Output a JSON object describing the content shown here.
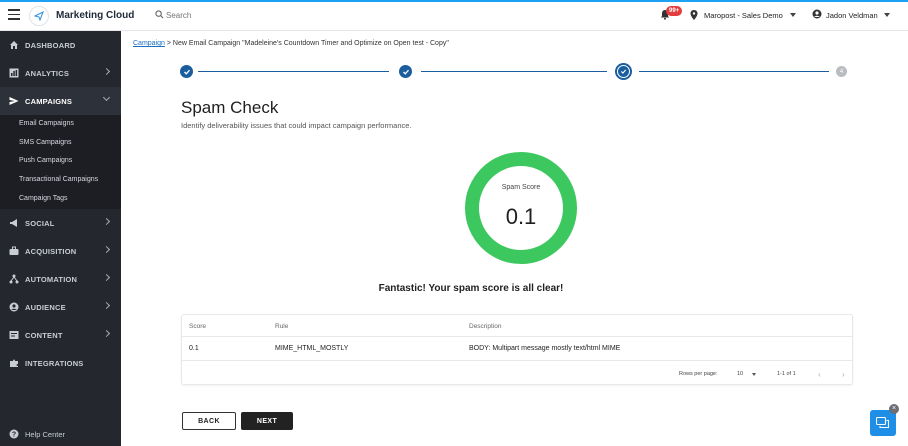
{
  "app": {
    "title": "Marketing Cloud"
  },
  "topbar": {
    "search_placeholder": "Search",
    "notification_badge": "99+",
    "account": "Maropost - Sales Demo",
    "user": "Jadon Veldman"
  },
  "sidebar": {
    "items": [
      {
        "label": "DASHBOARD",
        "icon": "home-icon"
      },
      {
        "label": "ANALYTICS",
        "icon": "chart-icon"
      },
      {
        "label": "CAMPAIGNS",
        "icon": "send-icon"
      },
      {
        "label": "SOCIAL",
        "icon": "megaphone-icon"
      },
      {
        "label": "ACQUISITION",
        "icon": "briefcase-icon"
      },
      {
        "label": "AUTOMATION",
        "icon": "flow-icon"
      },
      {
        "label": "AUDIENCE",
        "icon": "person-icon"
      },
      {
        "label": "CONTENT",
        "icon": "content-icon"
      },
      {
        "label": "INTEGRATIONS",
        "icon": "puzzle-icon"
      }
    ],
    "campaigns_sub": [
      "Email Campaigns",
      "SMS Campaigns",
      "Push Campaigns",
      "Transactional Campaigns",
      "Campaign Tags"
    ],
    "help": "Help Center"
  },
  "breadcrumb": {
    "link": "Campaign",
    "rest": " > New Email Campaign \"Madeleine's Countdown Timer and Optimize on Open test - Copy\""
  },
  "stepper": {
    "future_step": "4"
  },
  "page": {
    "title": "Spam Check",
    "subtitle": "Identify deliverability issues that could impact campaign performance."
  },
  "gauge": {
    "label": "Spam Score",
    "value": "0.1",
    "color": "#3cc85f"
  },
  "result_message": "Fantastic! Your spam score is all clear!",
  "table": {
    "headers": [
      "Score",
      "Rule",
      "Description"
    ],
    "rows": [
      [
        "0.1",
        "MIME_HTML_MOSTLY",
        "BODY: Multipart message mostly text/html MIME"
      ]
    ],
    "rows_per_page_label": "Rows per page:",
    "rows_per_page": "10",
    "range": "1-1 of 1"
  },
  "buttons": {
    "back": "BACK",
    "next": "NEXT"
  }
}
